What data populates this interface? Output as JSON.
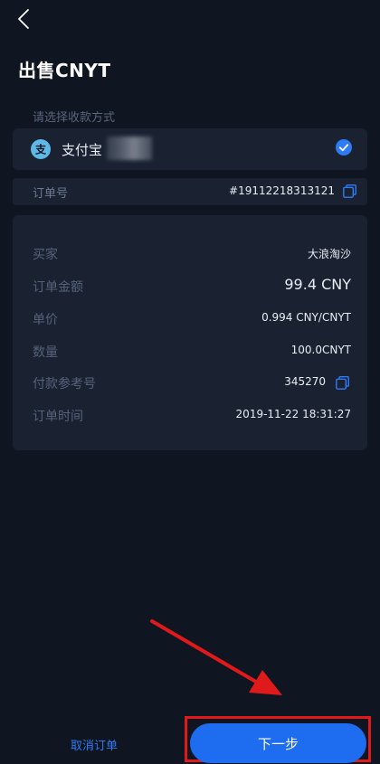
{
  "header": {
    "title": "出售CNYT"
  },
  "payment": {
    "section_label": "请选择收款方式",
    "method_name": "支付宝",
    "selected": true
  },
  "order": {
    "label": "订单号",
    "number": "#19112218313121"
  },
  "details": [
    {
      "label": "买家",
      "value": "大浪淘沙"
    },
    {
      "label": "订单金额",
      "value": "99.4 CNY"
    },
    {
      "label": "单价",
      "value": "0.994 CNY/CNYT"
    },
    {
      "label": "数量",
      "value": "100.0CNYT"
    },
    {
      "label": "付款参考号",
      "value": "345270"
    },
    {
      "label": "订单时间",
      "value": "2019-11-22 18:31:27"
    }
  ],
  "footer": {
    "cancel_label": "取消订单",
    "next_label": "下一步"
  },
  "colors": {
    "background": "#0f1521",
    "card": "#1a2232",
    "accent": "#1e6cf0",
    "annotation": "#e0191b"
  },
  "icons": {
    "back": "chevron-left-icon",
    "alipay": "alipay-icon",
    "check": "check-circle-icon",
    "copy": "copy-icon"
  }
}
